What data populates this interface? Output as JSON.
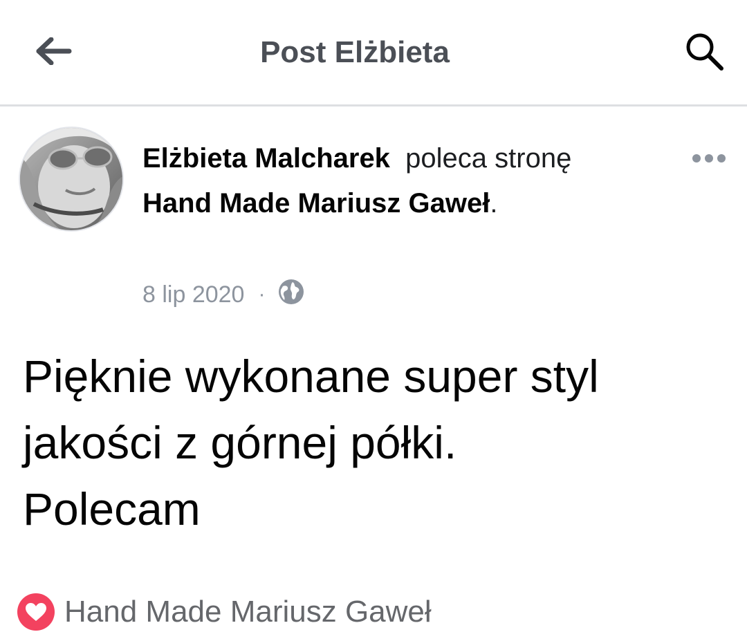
{
  "header": {
    "title": "Post Elżbieta",
    "back_icon": "arrow-left-icon",
    "search_icon": "search-icon"
  },
  "post": {
    "author": "Elżbieta Malcharek",
    "action_text": "poleca stronę",
    "page_name": "Hand Made Mariusz Gaweł",
    "trailing": ".",
    "date": "8 lip 2020",
    "separator": "·",
    "privacy_icon": "globe-icon",
    "more_icon": "more-horizontal-icon",
    "text_line1": "Pięknie wykonane super styl",
    "text_line2": "jakości z górnej półki.",
    "text_line3": "Polecam"
  },
  "footer": {
    "recommend_icon": "heart-icon",
    "page_name": "Hand Made Mariusz Gaweł"
  },
  "colors": {
    "title": "#4b4f56",
    "muted": "#8d949e",
    "heart": "#f3425f",
    "divider": "#dddfe2"
  }
}
